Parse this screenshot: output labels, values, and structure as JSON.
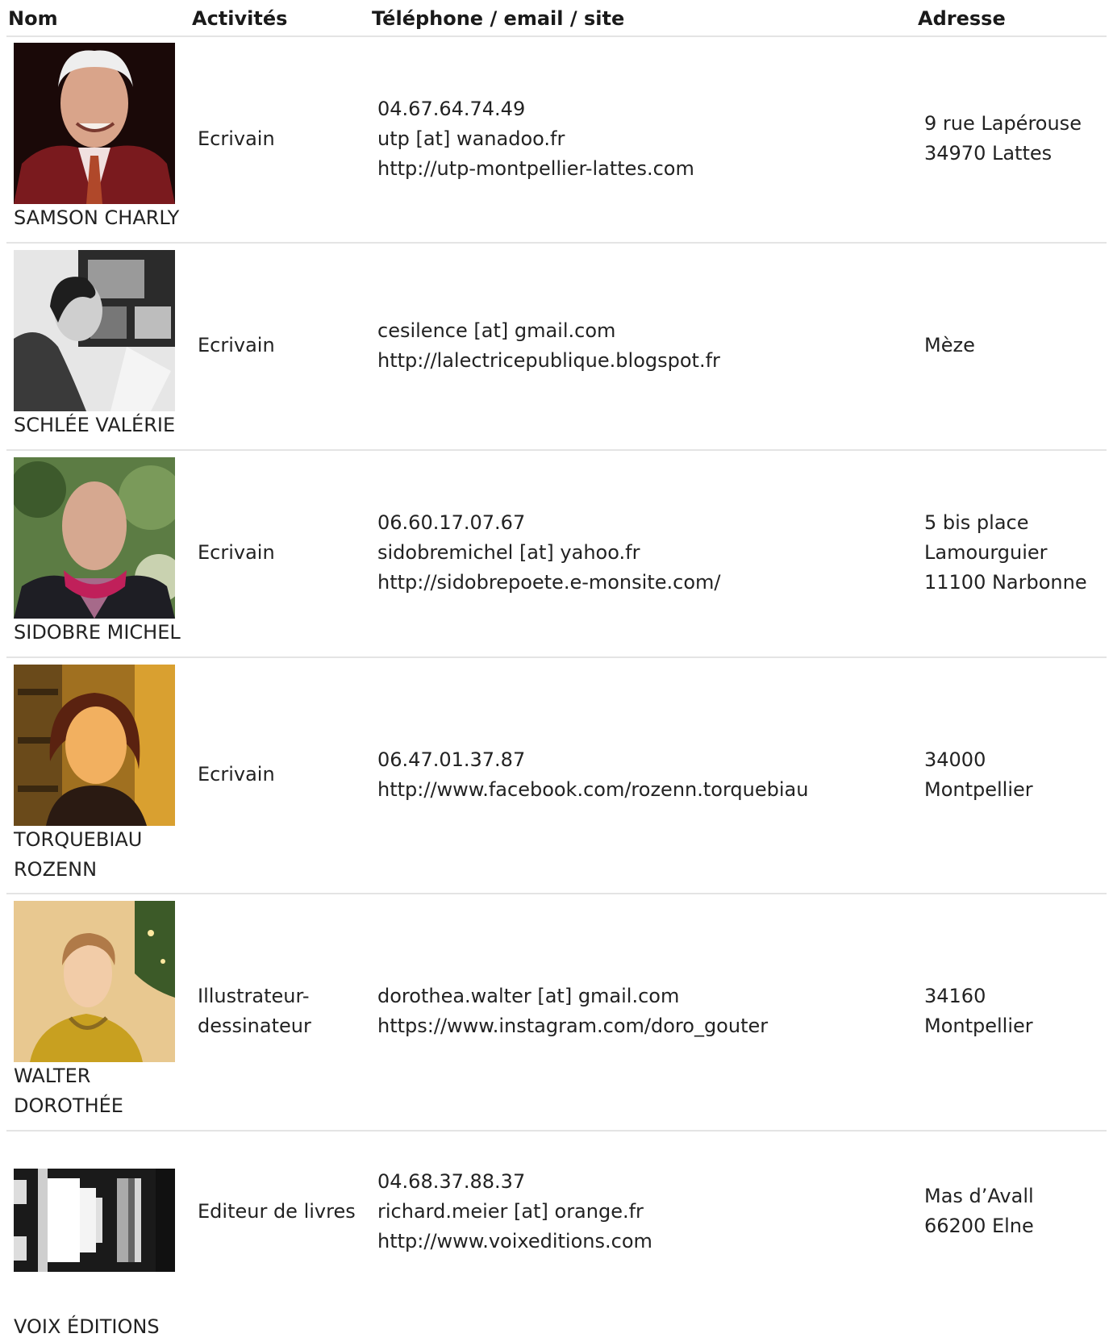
{
  "header": {
    "nom": "Nom",
    "activites": "Activités",
    "contact": "Téléphone / email / site",
    "adresse": "Adresse"
  },
  "rows": [
    {
      "name": "SAMSON CHARLY",
      "activity": "Ecrivain",
      "contact": "04.67.64.74.49\nutp [at] wanadoo.fr\nhttp://utp-montpellier-lattes.com",
      "address": "9 rue Lapérouse\n34970 Lattes",
      "photo": "portrait-photo"
    },
    {
      "name": "SCHLÉE VALÉRIE",
      "activity": "Ecrivain",
      "contact": "cesilence [at] gmail.com\nhttp://lalectricepublique.blogspot.fr",
      "address": "Mèze",
      "photo": "portrait-photo"
    },
    {
      "name": "SIDOBRE MICHEL",
      "activity": "Ecrivain",
      "contact": "06.60.17.07.67\nsidobremichel [at] yahoo.fr\nhttp://sidobrepoete.e-monsite.com/",
      "address": "5 bis place\nLamourguier\n11100 Narbonne",
      "photo": "portrait-photo"
    },
    {
      "name": "TORQUEBIAU\nROZENN",
      "activity": "Ecrivain",
      "contact": "06.47.01.37.87\nhttp://www.facebook.com/rozenn.torquebiau",
      "address": "34000\nMontpellier",
      "photo": "portrait-photo"
    },
    {
      "name": "WALTER\nDOROTHÉE",
      "activity": "Illustrateur-\ndessinateur",
      "contact": "dorothea.walter [at] gmail.com\nhttps://www.instagram.com/doro_gouter",
      "address": "34160\nMontpellier",
      "photo": "portrait-photo"
    },
    {
      "name": "VOIX ÉDITIONS",
      "activity": "Editeur de livres",
      "contact": "04.68.37.88.37\nrichard.meier [at] orange.fr\nhttp://www.voixeditions.com",
      "address": "Mas d’Avall\n66200 Elne",
      "photo": "logo-image"
    }
  ]
}
